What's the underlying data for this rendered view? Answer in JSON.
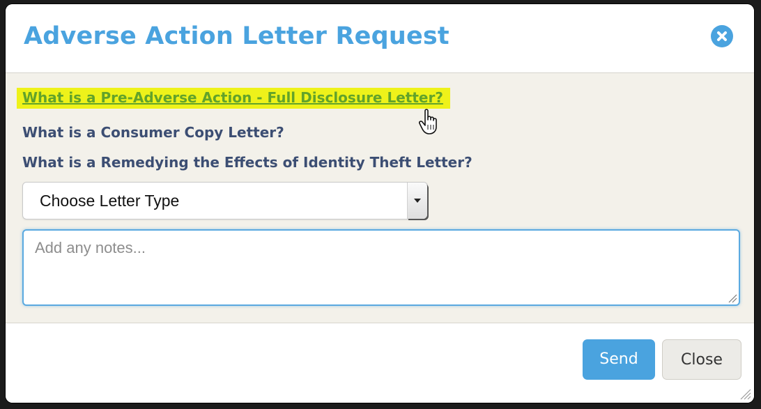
{
  "dialog": {
    "title": "Adverse Action Letter Request",
    "close_icon": "close-circle-icon",
    "accent_color": "#4aa3df"
  },
  "info_links": [
    {
      "label": "What is a Pre-Adverse Action - Full Disclosure Letter?",
      "highlighted": true,
      "highlight_color": "#eef21a"
    },
    {
      "label": "What is a Consumer Copy Letter?",
      "highlighted": false
    },
    {
      "label": "What is a Remedying the Effects of Identity Theft Letter?",
      "highlighted": false
    }
  ],
  "letter_type_select": {
    "selected_value": "Choose Letter Type",
    "arrow_icon": "caret-down-icon"
  },
  "notes_field": {
    "value": "",
    "placeholder": "Add any notes..."
  },
  "footer": {
    "send_label": "Send",
    "close_label": "Close"
  },
  "cursor_icon": "hand-pointer-icon"
}
